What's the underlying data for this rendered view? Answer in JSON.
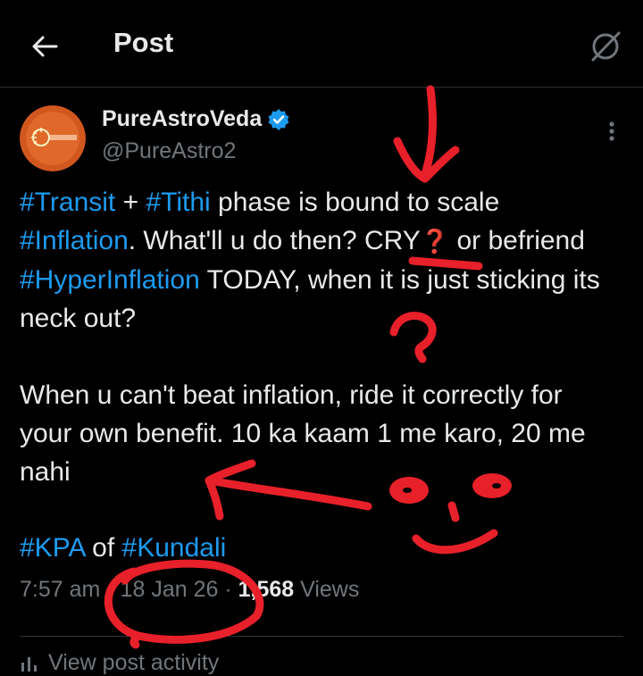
{
  "topbar": {
    "title": "Post"
  },
  "author": {
    "display_name": "PureAstroVeda",
    "handle": "@PureAstro2",
    "verified": true
  },
  "post": {
    "line1_pre": "",
    "tag_transit": "#Transit",
    "plus": " + ",
    "tag_tithi": "#Tithi",
    "line1_post": " phase is bound to scale ",
    "tag_inflation": "#Inflation",
    "text_a": ". What'll u do then? CRY",
    "text_b": " or befriend ",
    "tag_hyper": "#HyperInflation",
    "text_c": " TODAY, when it is just sticking its neck out?",
    "paragraph2": "When u can't beat inflation, ride it correctly for your own benefit. 10 ka kaam 1 me karo, 20 me nahi",
    "tag_kpa": "#KPA",
    "of": " of ",
    "tag_kundali": "#Kundali"
  },
  "meta": {
    "time": "7:57 am",
    "sep1": " · ",
    "date": "18 Jan 26",
    "sep2": " · ",
    "views_count": "1,568",
    "views_label": " Views"
  },
  "activity": {
    "label": "View post activity"
  },
  "colors": {
    "background": "#000000",
    "text": "#e7e9ea",
    "muted": "#71767b",
    "link": "#1d9bf0",
    "verified": "#1d9bf0",
    "annotation": "#e8202a"
  },
  "icons": [
    "back-arrow-icon",
    "grok-icon",
    "verified-badge-icon",
    "more-icon",
    "bar-chart-icon"
  ]
}
